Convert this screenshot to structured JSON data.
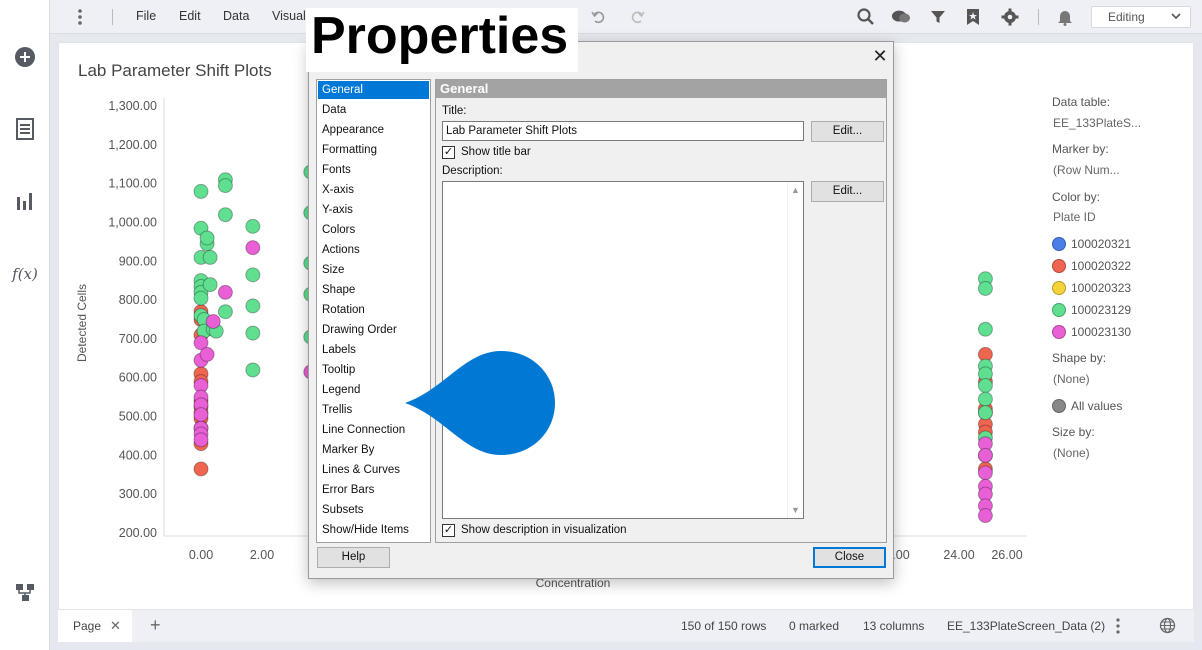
{
  "menu": {
    "file": "File",
    "edit": "Edit",
    "data": "Data",
    "visual": "Visuali",
    "mode": "Editing"
  },
  "viz_title": "Lab Parameter Shift Plots",
  "chart_data": {
    "type": "scatter",
    "ylabel": "Detected Cells",
    "xlabel": "Concentration",
    "yticks": [
      "1,300.00",
      "1,200.00",
      "1,100.00",
      "1,000.00",
      "900.00",
      "800.00",
      "700.00",
      "600.00",
      "500.00",
      "400.00",
      "300.00",
      "200.00"
    ],
    "xticks_left": [
      "0.00",
      "2.00"
    ],
    "xticks_right": [
      ".00",
      "24.00",
      "26.00"
    ],
    "ylim": [
      200,
      1300
    ],
    "series": [
      {
        "name": "100020321",
        "color": "#4a7fe8",
        "x": [],
        "y": []
      },
      {
        "name": "100020322",
        "color": "#f0654f",
        "x": [
          0,
          0,
          0,
          0,
          0,
          0,
          0,
          0,
          0,
          0,
          0,
          0,
          25.1,
          25.1,
          25.1,
          25.1,
          25.1,
          25.1,
          25.1,
          25.1
        ],
        "y": [
          770,
          750,
          710,
          610,
          590,
          525,
          510,
          495,
          470,
          430,
          365,
          540,
          660,
          590,
          510,
          480,
          460,
          400,
          365,
          520
        ]
      },
      {
        "name": "100020323",
        "color": "#f5d33b",
        "x": [],
        "y": []
      },
      {
        "name": "100023129",
        "color": "#5fdf8f",
        "x": [
          0,
          0,
          0,
          0,
          0,
          0,
          0,
          0,
          0.1,
          0.1,
          0.2,
          0.2,
          0.3,
          0.3,
          0.4,
          0.5,
          0.8,
          0.8,
          0.8,
          0.8,
          1.7,
          1.7,
          1.7,
          1.7,
          1.7,
          3.6,
          3.6,
          3.6,
          3.6,
          3.6,
          25.1,
          25.1,
          25.1,
          25.1,
          25.1,
          25.1,
          25.1,
          25.1,
          25.1
        ],
        "y": [
          1080,
          985,
          910,
          850,
          835,
          820,
          805,
          760,
          750,
          720,
          945,
          960,
          910,
          840,
          725,
          720,
          1110,
          1095,
          1020,
          770,
          990,
          865,
          785,
          715,
          620,
          1130,
          1025,
          895,
          815,
          705,
          855,
          830,
          725,
          630,
          610,
          580,
          545,
          510,
          445
        ]
      },
      {
        "name": "100023130",
        "color": "#e85fd6",
        "x": [
          0,
          0,
          0,
          0,
          0,
          0,
          0,
          0,
          0,
          0.2,
          0.4,
          0.8,
          1.7,
          3.6,
          25.1,
          25.1,
          25.1,
          25.1,
          25.1,
          25.1,
          25.1
        ],
        "y": [
          690,
          645,
          580,
          550,
          530,
          505,
          470,
          455,
          440,
          660,
          745,
          820,
          935,
          615,
          430,
          400,
          355,
          320,
          300,
          270,
          245
        ]
      }
    ]
  },
  "legend": {
    "data_table_label": "Data table:",
    "data_table_value": "EE_133PlateS...",
    "marker_by_label": "Marker by:",
    "marker_by_value": "(Row Num...",
    "color_by_label": "Color by:",
    "color_by_value": "Plate ID",
    "items": [
      {
        "label": "100020321",
        "color": "#4a7fe8"
      },
      {
        "label": "100020322",
        "color": "#f0654f"
      },
      {
        "label": "100020323",
        "color": "#f5d33b"
      },
      {
        "label": "100023129",
        "color": "#5fdf8f"
      },
      {
        "label": "100023130",
        "color": "#e85fd6"
      }
    ],
    "shape_by_label": "Shape by:",
    "shape_by_value": "(None)",
    "all_values": "All values",
    "size_by_label": "Size by:",
    "size_by_value": "(None)"
  },
  "bottom": {
    "page_tab": "Page",
    "rows": "150 of 150 rows",
    "marked": "0 marked",
    "columns": "13 columns",
    "table": "EE_133PlateScreen_Data (2)"
  },
  "banner": "Properties",
  "dialog": {
    "categories": [
      "General",
      "Data",
      "Appearance",
      "Formatting",
      "Fonts",
      "X-axis",
      "Y-axis",
      "Colors",
      "Actions",
      "Size",
      "Shape",
      "Rotation",
      "Drawing Order",
      "Labels",
      "Tooltip",
      "Legend",
      "Trellis",
      "Line Connection",
      "Marker By",
      "Lines & Curves",
      "Error Bars",
      "Subsets",
      "Show/Hide Items"
    ],
    "selected": "General",
    "pane_title": "General",
    "title_label": "Title:",
    "title_value": "Lab Parameter Shift Plots",
    "edit_label": "Edit...",
    "show_title_bar": "Show title bar",
    "description_label": "Description:",
    "show_description": "Show description in visualization",
    "help": "Help",
    "close": "Close"
  }
}
